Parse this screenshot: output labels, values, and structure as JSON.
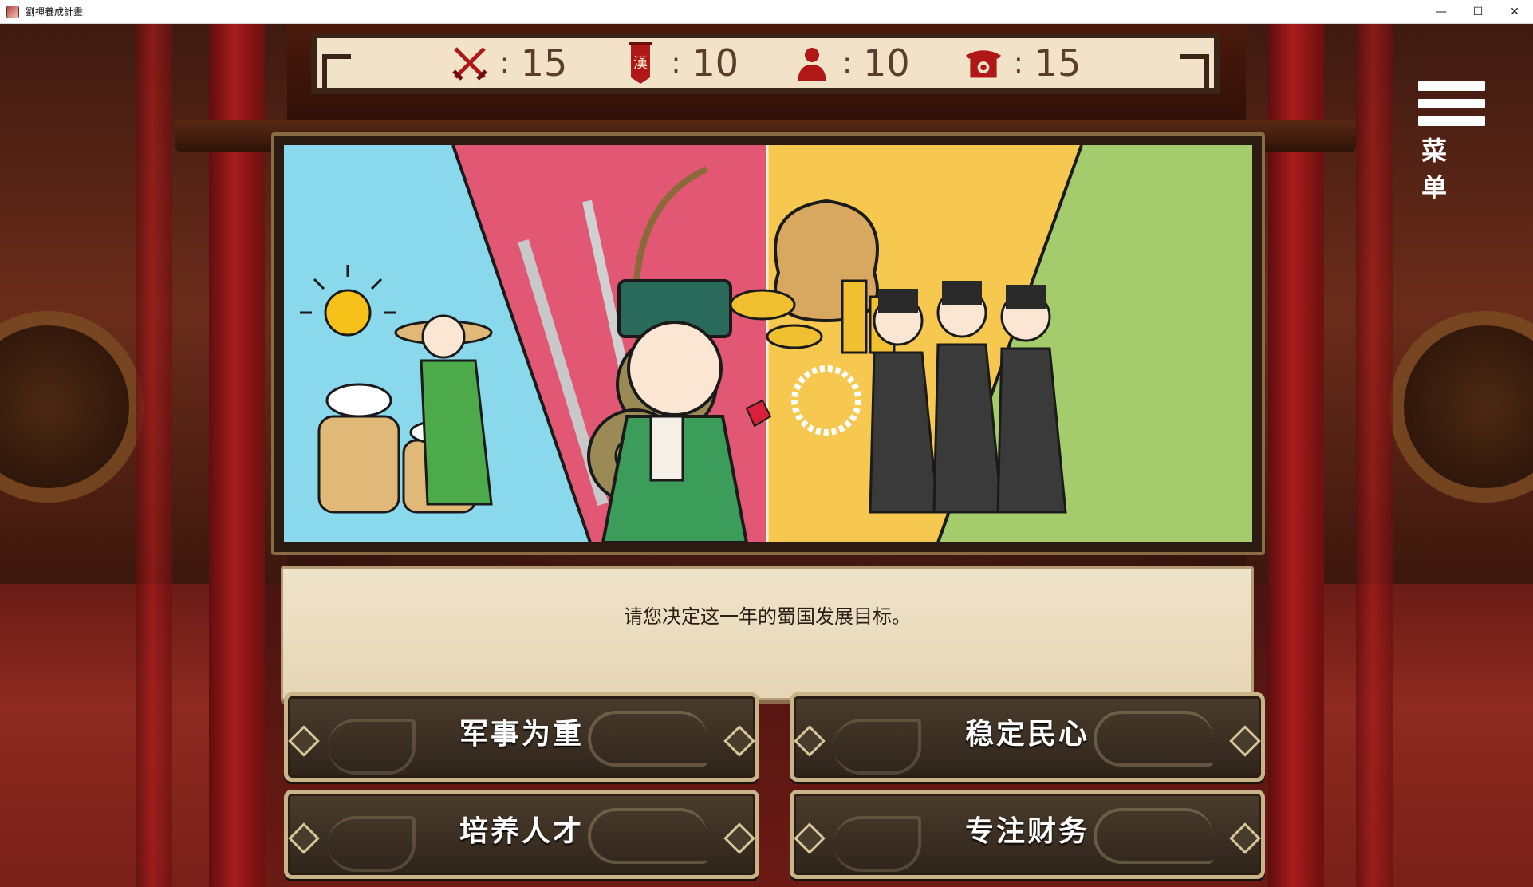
{
  "window": {
    "title": "劉禪養成計畫",
    "controls": {
      "minimize": "—",
      "maximize": "☐",
      "close": "✕"
    }
  },
  "stats": [
    {
      "icon": "crossed-swords-icon",
      "separator": ":",
      "value": "15"
    },
    {
      "icon": "han-banner-icon",
      "banner_glyph": "漢",
      "separator": ":",
      "value": "10"
    },
    {
      "icon": "people-icon",
      "separator": ":",
      "value": "10"
    },
    {
      "icon": "palace-icon",
      "separator": ":",
      "value": "15"
    }
  ],
  "menu": {
    "label": "菜单"
  },
  "dialog": {
    "text": "请您决定这一年的蜀国发展目标。"
  },
  "choices": [
    {
      "label": "军事为重"
    },
    {
      "label": "稳定民心"
    },
    {
      "label": "培养人才"
    },
    {
      "label": "专注财务"
    }
  ],
  "colors": {
    "panel_bg": "#f2e3c8",
    "panel_border": "#3a2418",
    "stat_text": "#5a3e2c",
    "button_bg": "#3a2e22",
    "button_border": "#c9b48a",
    "illus_blue": "#7ed3e8",
    "illus_red": "#e0506e",
    "illus_yellow": "#f4c24a",
    "illus_green": "#9cc862"
  }
}
